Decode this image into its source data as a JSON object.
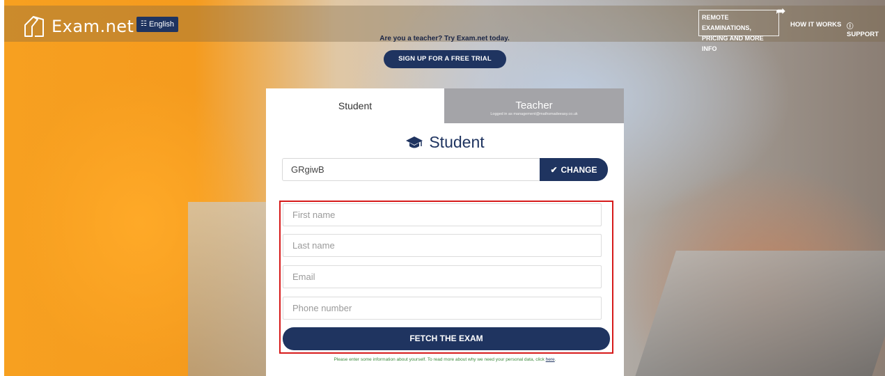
{
  "header": {
    "logo_text": "Exam.net",
    "language_label": "English",
    "remote_line1": "REMOTE EXAMINATIONS,",
    "remote_line2": "PRICING AND MORE INFO",
    "how_it_works": "HOW IT WORKS",
    "support": "ⓘ SUPPORT"
  },
  "cta": {
    "text": "Are you a teacher? Try Exam.net today.",
    "button": "SIGN UP FOR A FREE TRIAL"
  },
  "tabs": {
    "student": "Student",
    "teacher": "Teacher",
    "teacher_sub": "Logged in as management@mathsmadeeasy.co.uk"
  },
  "student": {
    "heading": "Student",
    "exam_code": "GRgiwB",
    "change_button": "CHANGE"
  },
  "form": {
    "first_name_placeholder": "First name",
    "last_name_placeholder": "Last name",
    "email_placeholder": "Email",
    "phone_placeholder": "Phone number",
    "fetch_button": "FETCH THE EXAM",
    "note_text": "Please enter some information about yourself. To read more about why we need your personal data, click ",
    "note_link": "here",
    "note_end": "."
  },
  "colors": {
    "navy": "#1f3460",
    "highlight_red": "#d61a1a",
    "teacher_tab": "#a4a4a8"
  }
}
